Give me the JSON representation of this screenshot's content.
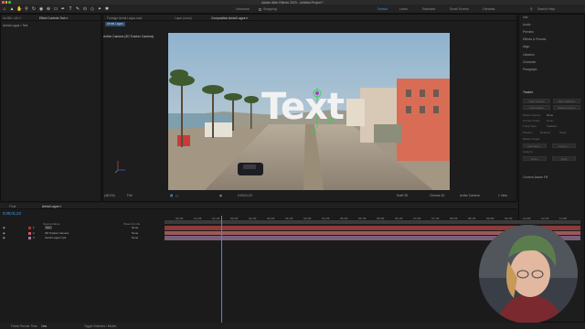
{
  "window": {
    "title": "Adobe After Effects 2023 - Untitled Project *",
    "close_color": "#ff5f57",
    "min_color": "#febc2e",
    "max_color": "#28c840"
  },
  "toolbar": {
    "tools": [
      "home-icon",
      "selection-tool-icon",
      "hand-tool-icon",
      "zoom-tool-icon",
      "rotate-tool-icon",
      "camera-tool-icon",
      "pan-behind-tool-icon",
      "rectangle-tool-icon",
      "pen-tool-icon",
      "type-tool-icon",
      "brush-tool-icon",
      "clone-stamp-tool-icon",
      "eraser-tool-icon",
      "roto-brush-tool-icon",
      "puppet-tool-icon"
    ],
    "tool_glyphs": [
      "⌂",
      "▲",
      "✋",
      "⚲",
      "↻",
      "◉",
      "⊕",
      "▭",
      "✒",
      "T",
      "✎",
      "⊙",
      "◇",
      "✦",
      "✱"
    ],
    "universal_label": "Universal",
    "snapping_label": "Snapping",
    "workspaces": [
      "Default",
      "Learn",
      "Standard",
      "Small Screen",
      "Libraries"
    ],
    "active_workspace": "Default",
    "search_placeholder": "Search Help"
  },
  "left_panel": {
    "tabs": [
      "ion Bin: Lit1 ≡",
      "Effect Controls Text ≡"
    ],
    "breadcrumb": "Aerial Lagos • Text"
  },
  "comp_panel": {
    "tabs": [
      "Footage Aerial Lagos.mp4",
      "Layer (none)",
      "Composition Aerial Lagos ≡"
    ],
    "comp_tab": "Aerial Lagos",
    "camera_label": "Active Camera (3D Tracker Camera)",
    "overlay_text": "Text",
    "bottom_bar": {
      "zoom": "(48.2%)",
      "quality": "Full",
      "timecode": "0;00;01;23",
      "draft_label": "Draft 3D",
      "renderer": "Cinema 4D",
      "view": "Active Camera",
      "views": "1 View"
    }
  },
  "right_panel": {
    "items": [
      "Info",
      "Audio",
      "Preview",
      "Effects & Presets",
      "Align",
      "Libraries",
      "Character",
      "Paragraph",
      "Tracker"
    ],
    "tracker_buttons": [
      "Track Camera",
      "Warp Stabilizer",
      "Track Motion",
      "Stabilize Motion"
    ],
    "motion_source_label": "Motion Source:",
    "motion_source_value": "None",
    "current_track_label": "Current Track:",
    "current_track_value": "None",
    "track_type_label": "Track Type:",
    "track_type_value": "Stabilize",
    "checkboxes": [
      "Position",
      "Rotation",
      "Scale"
    ],
    "motion_target_label": "Motion Target:",
    "edit_target_label": "Edit Target...",
    "options_label": "Options...",
    "analyze_label": "Analyze:",
    "reset_label": "Reset",
    "apply_label": "Apply",
    "content_aware_fill": "Content-Aware Fill"
  },
  "timeline": {
    "tabs": [
      "Final",
      "Aerial Lagos ≡"
    ],
    "current_time": "0;00;01;23",
    "columns": [
      "Source Name",
      "Parent & Link"
    ],
    "layers": [
      {
        "num": "1",
        "name": "Text",
        "parent": "None",
        "color": "#b52e2e"
      },
      {
        "num": "2",
        "name": "3D Tracker Camera",
        "parent": "None",
        "color": "#c46060"
      },
      {
        "num": "3",
        "name": "Aerial Lagos.mp4",
        "parent": "None",
        "color": "#a77ba7"
      }
    ],
    "ruler": [
      "00;15f",
      "01;00f",
      "01;15f",
      "02;00f",
      "02;15f",
      "03;00f",
      "03;15f",
      "04;00f",
      "04;15f",
      "05;00f",
      "05;15f",
      "06;00f",
      "06;15f",
      "07;00f",
      "07;15f",
      "08;00f",
      "08;15f",
      "09;00f",
      "09;15f",
      "10;00f",
      "10;15f",
      "11;00f"
    ],
    "playhead_fraction": 0.136
  },
  "status_bar": {
    "frame_render_label": "Frame Render Time:",
    "frame_render_value": "1ms",
    "toggle_label": "Toggle Switches / Modes"
  }
}
